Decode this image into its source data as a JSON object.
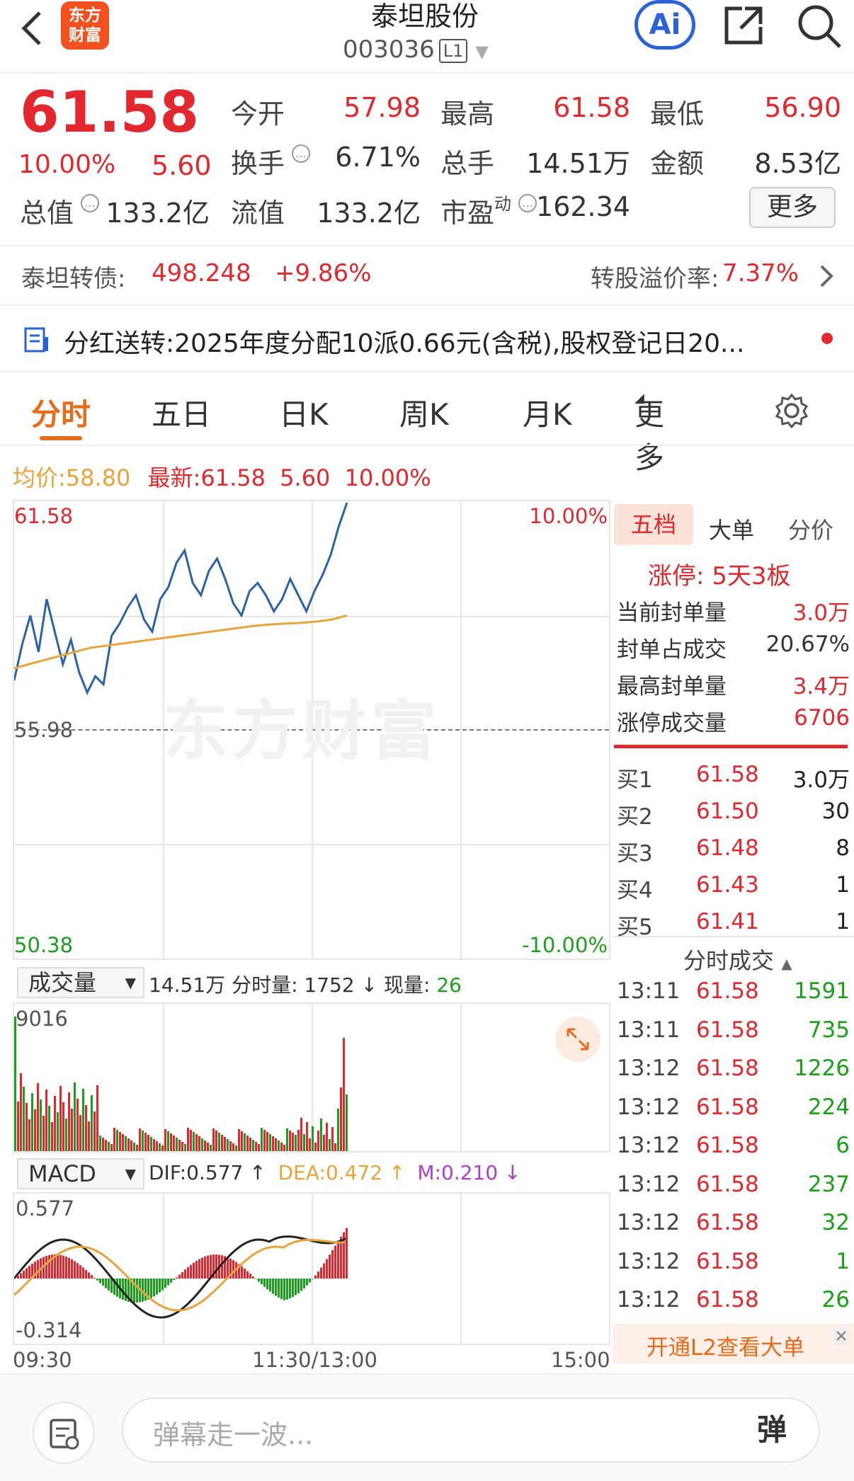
{
  "header": {
    "back_icon": "chevron-left-icon",
    "logo_line1": "东方",
    "logo_line2": "财富",
    "title": "泰坦股份",
    "code": "003036",
    "level": "L1",
    "ai_label": "Ai",
    "share_icon": "share-icon",
    "search_icon": "search-icon"
  },
  "quote": {
    "price": "61.58",
    "pct": "10.00%",
    "change": "5.60",
    "fields": [
      {
        "k": "今开",
        "v": "57.98",
        "color": "#e0282e"
      },
      {
        "k": "最高",
        "v": "61.58",
        "color": "#e0282e"
      },
      {
        "k": "最低",
        "v": "56.90",
        "color": "#e0282e"
      },
      {
        "k": "换手",
        "v": "6.71%",
        "color": "#333"
      },
      {
        "k": "总手",
        "v": "14.51万",
        "color": "#333"
      },
      {
        "k": "金额",
        "v": "8.53亿",
        "color": "#333"
      },
      {
        "k": "总值",
        "v": "133.2亿",
        "color": "#333"
      },
      {
        "k": "流值",
        "v": "133.2亿",
        "color": "#333"
      },
      {
        "k": "市盈",
        "v": "162.34",
        "color": "#333"
      }
    ],
    "pe_super": "动",
    "more": "更多"
  },
  "bond": {
    "label": "泰坦转债:",
    "price": "498.248",
    "pct": "+9.86%",
    "premium_label": "转股溢价率:",
    "premium": "7.37%"
  },
  "dividend": {
    "text": "分红送转:2025年度分配10派0.66元(含税),股权登记日20..."
  },
  "tabs": [
    "分时",
    "五日",
    "日K",
    "周K",
    "月K",
    "更多"
  ],
  "avg_line": {
    "avg_label": "均价:",
    "avg": "58.80",
    "latest_label": "最新:",
    "latest": "61.58",
    "chg": "5.60",
    "pct": "10.00%"
  },
  "chart_data": [
    {
      "type": "line",
      "title": "分时",
      "y_labels_left": [
        "61.58",
        "55.98",
        "50.38"
      ],
      "y_labels_right": [
        "10.00%",
        "-10.00%"
      ],
      "x_labels": [
        "09:30",
        "11:30/13:00",
        "15:00"
      ],
      "series": [
        {
          "name": "价格",
          "color": "#2a62a8",
          "values": [
            57.2,
            58.1,
            58.8,
            57.9,
            59.2,
            58.4,
            57.6,
            58.2,
            57.4,
            56.9,
            57.3,
            57.1,
            58.3,
            58.6,
            59.0,
            59.3,
            58.7,
            58.4,
            59.2,
            59.5,
            60.1,
            60.4,
            59.6,
            59.3,
            59.9,
            60.2,
            59.7,
            59.1,
            58.8,
            59.4,
            59.6,
            59.3,
            58.9,
            59.2,
            59.7,
            59.3,
            58.9,
            59.4,
            59.8,
            60.3,
            61.0,
            61.58
          ]
        },
        {
          "name": "均价",
          "color": "#e8a33a",
          "values": [
            57.5,
            57.6,
            57.7,
            57.8,
            57.9,
            58.0,
            58.05,
            58.1,
            58.15,
            58.2,
            58.25,
            58.3,
            58.35,
            58.4,
            58.45,
            58.5,
            58.55,
            58.58,
            58.6,
            58.62,
            58.65,
            58.7,
            58.8
          ]
        }
      ]
    },
    {
      "type": "bar",
      "title": "成交量",
      "label": "成交量",
      "total": "14.51万",
      "minute_label": "分时量:",
      "minute": "1752",
      "now_label": "现量:",
      "now": "26",
      "ymax_label": "9016"
    },
    {
      "type": "bar",
      "title": "MACD",
      "label": "MACD",
      "dif": "DIF:0.577",
      "dea": "DEA:0.472",
      "m": "M:0.210",
      "ymax_label": "0.577",
      "ymin_label": "-0.314"
    }
  ],
  "side": {
    "tabs": [
      "五档",
      "大单",
      "分价"
    ],
    "limit": "涨停: 5天3板",
    "limit_info": [
      {
        "k": "当前封单量",
        "v": "3.0万",
        "color": "#e0282e"
      },
      {
        "k": "封单占成交",
        "v": "20.67%",
        "color": "#333"
      },
      {
        "k": "最高封单量",
        "v": "3.4万",
        "color": "#e0282e"
      },
      {
        "k": "涨停成交量",
        "v": "6706",
        "color": "#e0282e"
      }
    ],
    "bids": [
      {
        "k": "买1",
        "p": "61.58",
        "q": "3.0万"
      },
      {
        "k": "买2",
        "p": "61.50",
        "q": "30"
      },
      {
        "k": "买3",
        "p": "61.48",
        "q": "8"
      },
      {
        "k": "买4",
        "p": "61.43",
        "q": "1"
      },
      {
        "k": "买5",
        "p": "61.41",
        "q": "1"
      }
    ],
    "trades_title": "分时成交",
    "trades": [
      {
        "t": "13:11",
        "p": "61.58",
        "q": "1591"
      },
      {
        "t": "13:11",
        "p": "61.58",
        "q": "735"
      },
      {
        "t": "13:12",
        "p": "61.58",
        "q": "1226"
      },
      {
        "t": "13:12",
        "p": "61.58",
        "q": "224"
      },
      {
        "t": "13:12",
        "p": "61.58",
        "q": "6"
      },
      {
        "t": "13:12",
        "p": "61.58",
        "q": "237"
      },
      {
        "t": "13:12",
        "p": "61.58",
        "q": "32"
      },
      {
        "t": "13:12",
        "p": "61.58",
        "q": "1"
      },
      {
        "t": "13:12",
        "p": "61.58",
        "q": "26"
      }
    ],
    "l2": "开通L2查看大单"
  },
  "watermark": "东方财富",
  "bottom": {
    "placeholder": "弹幕走一波...",
    "barrage_btn": "弹"
  }
}
